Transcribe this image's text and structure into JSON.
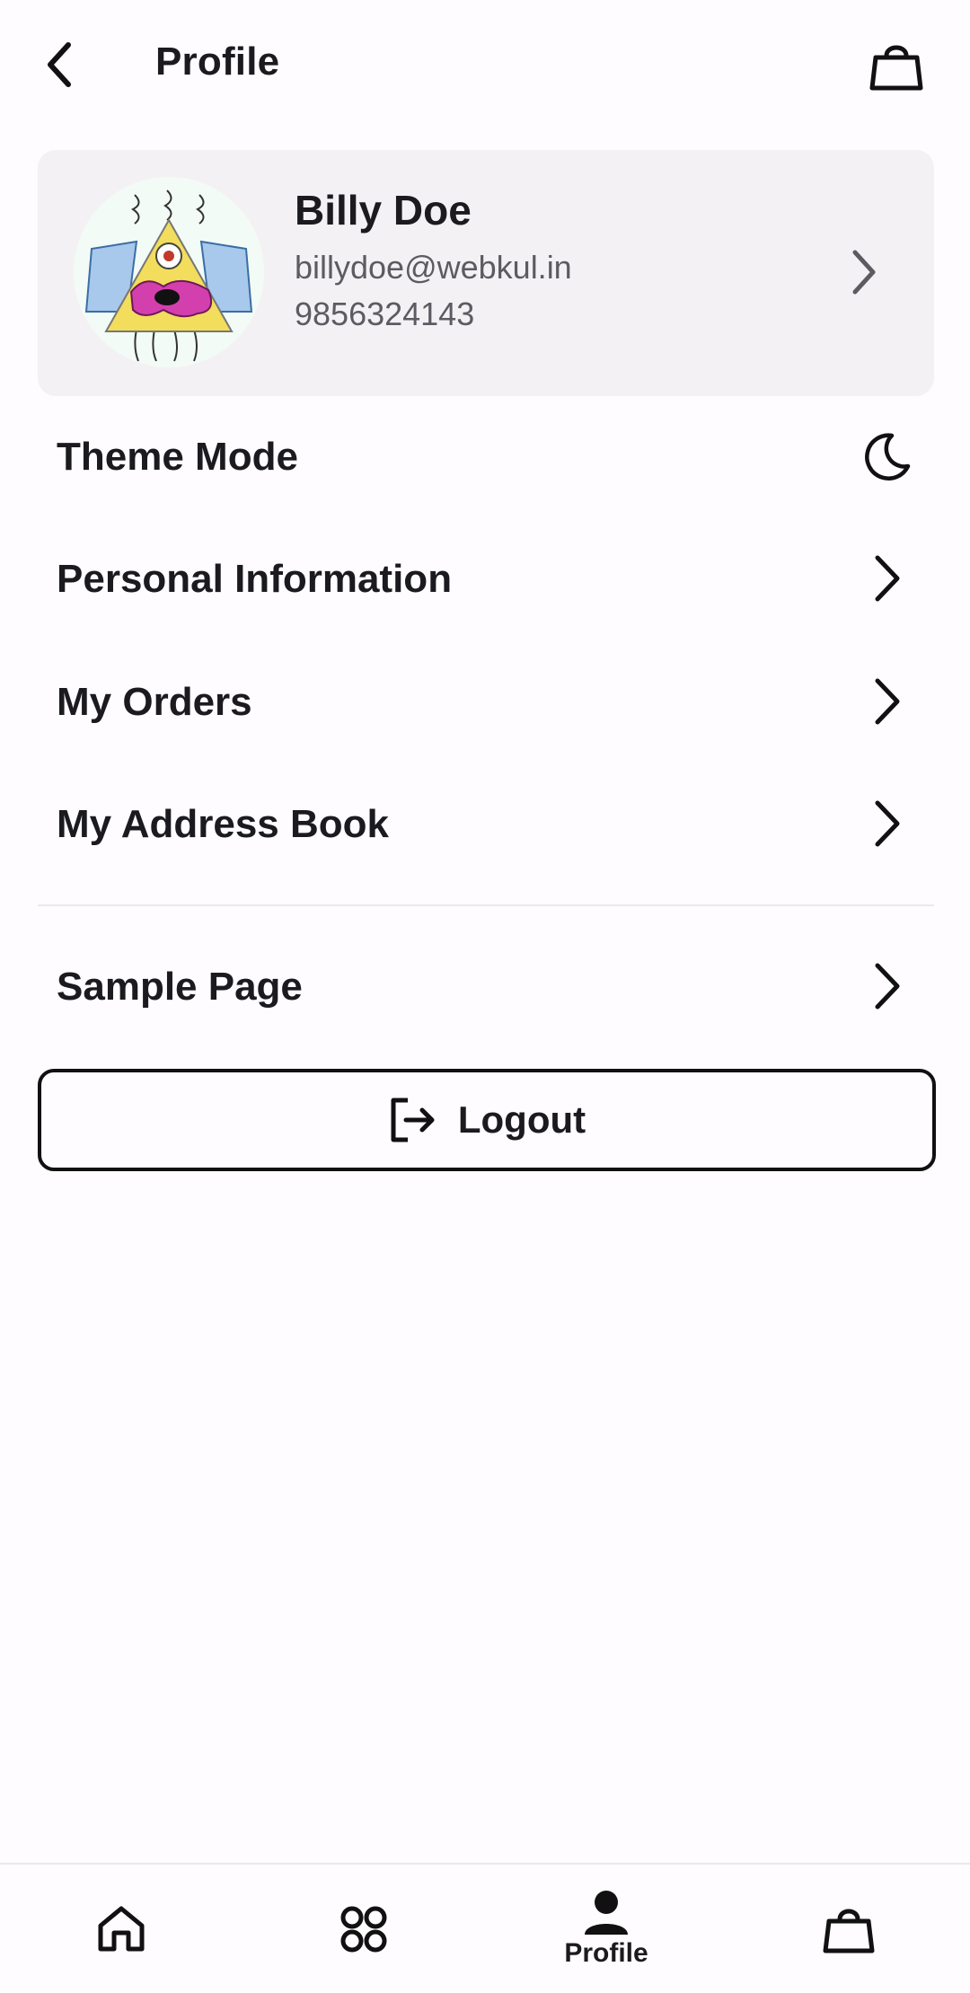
{
  "header": {
    "title": "Profile",
    "back_icon": "chevron-left-icon",
    "cart_icon": "shopping-bag-icon"
  },
  "profile": {
    "name": "Billy Doe",
    "email": "billydoe@webkul.in",
    "phone": "9856324143",
    "avatar_icon": "cartoon-avatar"
  },
  "menu": {
    "theme_mode": "Theme Mode",
    "personal_information": "Personal Information",
    "my_orders": "My Orders",
    "my_address_book": "My Address Book",
    "sample_page": "Sample Page"
  },
  "logout": {
    "label": "Logout"
  },
  "bottom_nav": {
    "items": [
      {
        "icon": "home-icon",
        "label": ""
      },
      {
        "icon": "categories-icon",
        "label": ""
      },
      {
        "icon": "person-icon",
        "label": "Profile"
      },
      {
        "icon": "shopping-bag-icon",
        "label": ""
      }
    ],
    "active_index": 2
  },
  "colors": {
    "background": "#fefcfe",
    "card": "#f4f1f5",
    "text": "#1b1b1f",
    "secondary_text": "#5d5b61"
  }
}
